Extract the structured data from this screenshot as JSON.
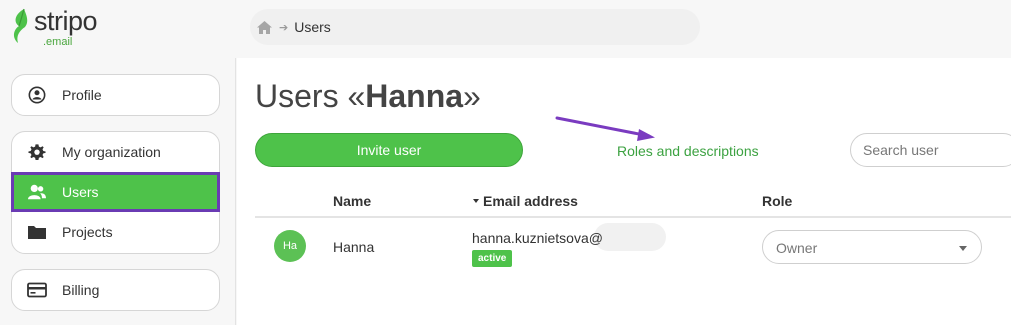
{
  "logo": {
    "word": "stripo",
    "sub": ".email"
  },
  "breadcrumb": {
    "home_icon": "home-icon",
    "current": "Users"
  },
  "sidebar": {
    "profile": {
      "label": "Profile",
      "icon": "user-circle-icon"
    },
    "items": [
      {
        "label": "My organization",
        "icon": "gear-icon"
      },
      {
        "label": "Users",
        "icon": "users-icon",
        "active": true
      },
      {
        "label": "Projects",
        "icon": "folder-icon"
      }
    ],
    "billing": {
      "label": "Billing",
      "icon": "credit-card-icon"
    }
  },
  "main": {
    "title_prefix": "Users «",
    "title_name": "Hanna",
    "title_suffix": "»",
    "invite_label": "Invite user",
    "roles_link": "Roles and descriptions",
    "search_placeholder": "Search user",
    "columns": {
      "name": "Name",
      "email": "Email address",
      "role": "Role"
    },
    "users": [
      {
        "initials": "Ha",
        "name": "Hanna",
        "email": "hanna.kuznietsova@",
        "status": "active",
        "role": "Owner"
      }
    ]
  },
  "colors": {
    "accent": "#4ec24a",
    "highlight": "#6a3bb3",
    "link": "#3ca241"
  }
}
